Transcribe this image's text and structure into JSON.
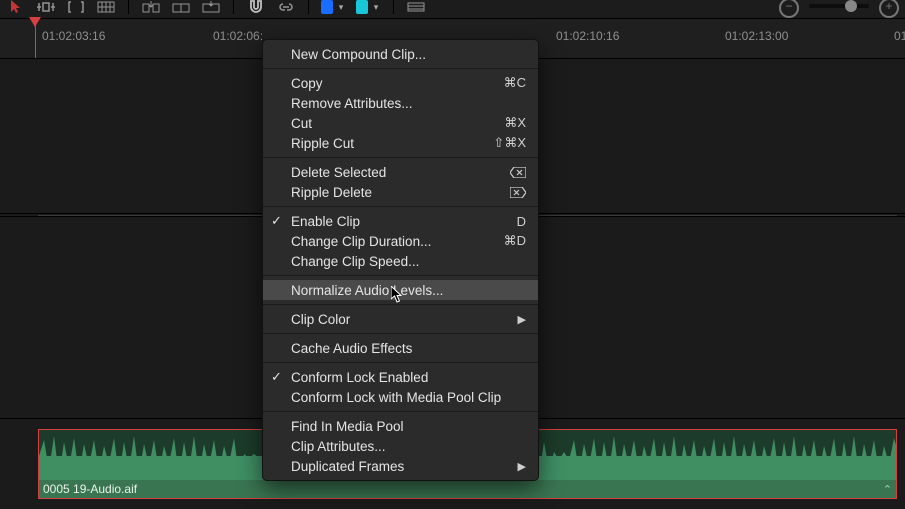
{
  "ruler": {
    "ticks": [
      "01:02:03:16",
      "01:02:06:",
      "01:02:10:16",
      "01:02:13:00",
      "01"
    ]
  },
  "clip": {
    "name": "0005 19-Audio.aif"
  },
  "menu": {
    "new_compound": "New Compound Clip...",
    "copy": "Copy",
    "copy_sc": "⌘C",
    "remove_attrs": "Remove Attributes...",
    "cut": "Cut",
    "cut_sc": "⌘X",
    "ripple_cut": "Ripple Cut",
    "ripple_cut_sc": "⇧⌘X",
    "delete_selected": "Delete Selected",
    "ripple_delete": "Ripple Delete",
    "enable_clip": "Enable Clip",
    "enable_clip_sc": "D",
    "change_duration": "Change Clip Duration...",
    "change_duration_sc": "⌘D",
    "change_speed": "Change Clip Speed...",
    "normalize_audio": "Normalize Audio Levels...",
    "clip_color": "Clip Color",
    "cache_audio": "Cache Audio Effects",
    "conform_lock_enabled": "Conform Lock Enabled",
    "conform_lock_media": "Conform Lock with Media Pool Clip",
    "find_in_media_pool": "Find In Media Pool",
    "clip_attributes": "Clip Attributes...",
    "duplicated_frames": "Duplicated Frames"
  }
}
